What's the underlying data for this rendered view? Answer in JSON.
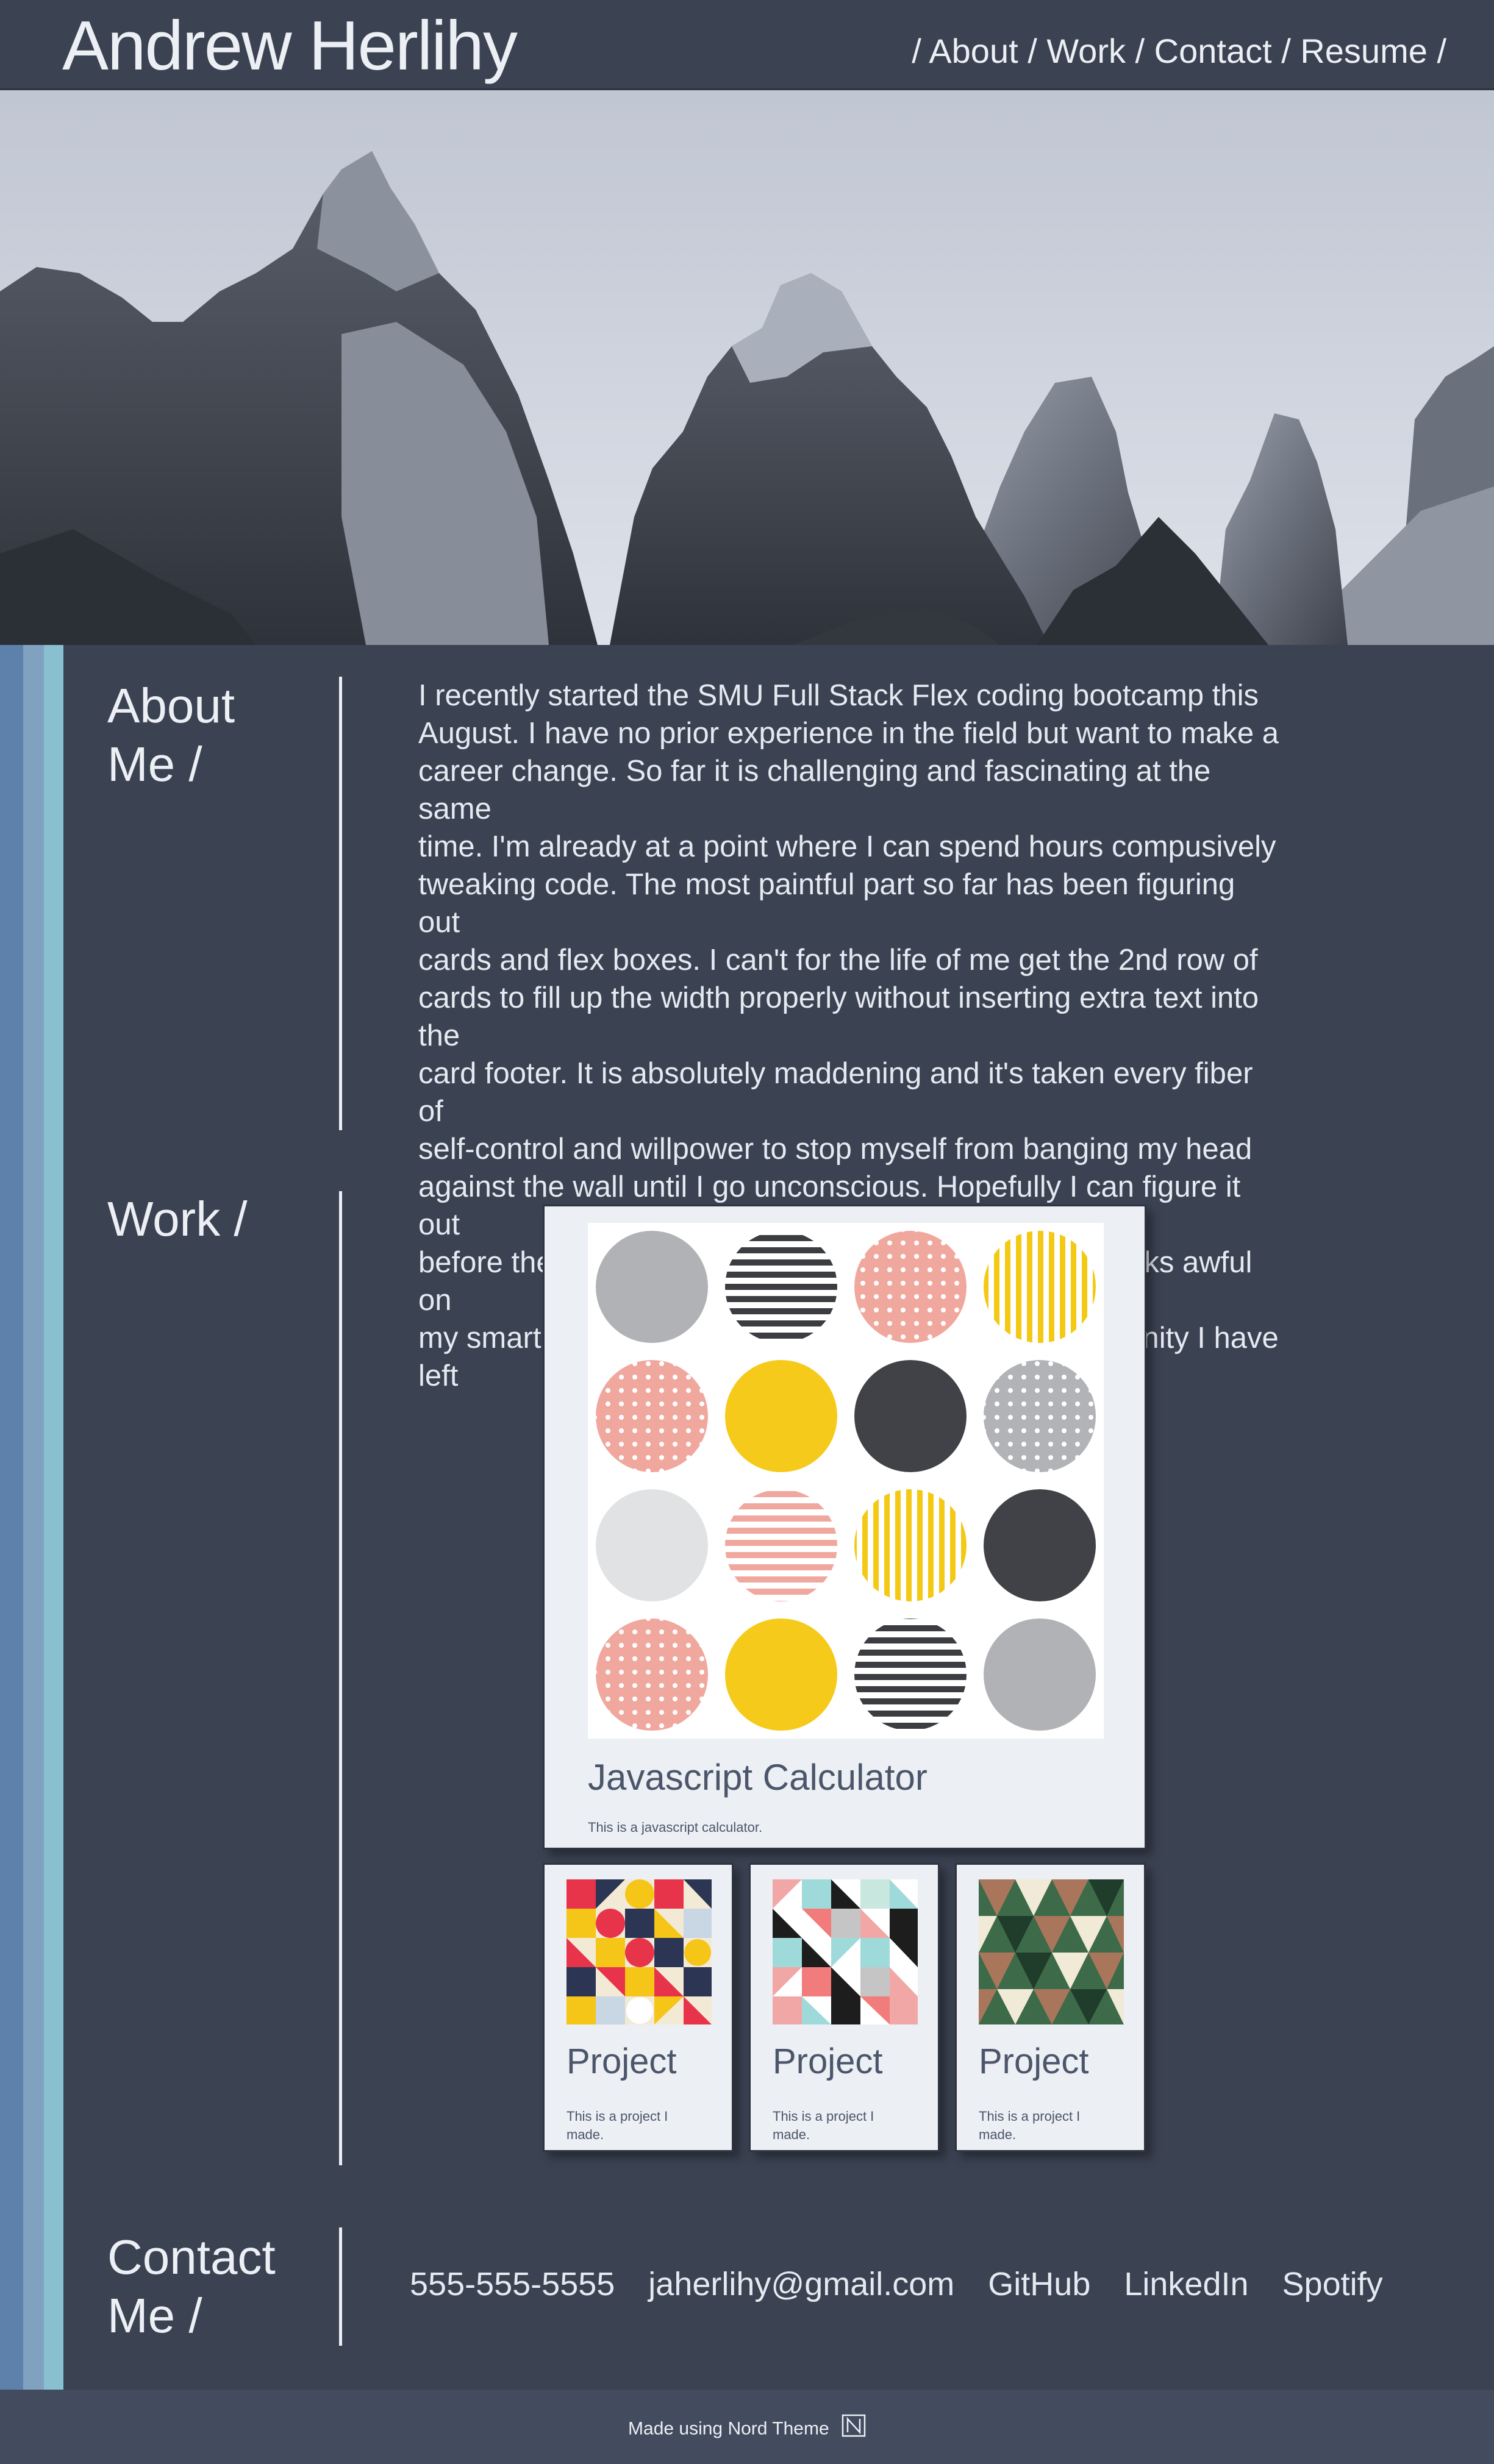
{
  "header": {
    "title": "Andrew Herlihy",
    "nav": [
      {
        "label": "About"
      },
      {
        "label": "Work"
      },
      {
        "label": "Contact"
      },
      {
        "label": "Resume"
      }
    ],
    "separator": "/"
  },
  "about": {
    "title_line1": "About",
    "title_line2": "Me /",
    "lines": [
      "I recently started the SMU Full Stack Flex coding bootcamp this",
      "August. I have no prior experience in the field but want to make a",
      "career change. So far it is challenging and fascinating at the same",
      "time. I'm already at a point where I can spend hours compusively",
      "tweaking code. The most paintful part so far has been figuring out",
      "cards and flex boxes. I can't for the life of me get the 2nd row of",
      "cards to fill up the width properly without inserting extra text into the",
      "card footer. It is absolutely maddening and it's taken every fiber of",
      "self-control and willpower to stop myself from banging my head",
      "against the wall until I go unconscious. Hopefully I can figure it out",
      "before the weekend gets here. Also, if my webpage looks awful on",
      "my smart phone I think I might lose the last shred of sanity I have left"
    ]
  },
  "work": {
    "title": "Work /",
    "main_card": {
      "title": "Javascript Calculator",
      "text": "This is a javascript calculator."
    },
    "small_cards": [
      {
        "title": "Project",
        "text_line1": "This is a project I",
        "text_line2": "made."
      },
      {
        "title": "Project",
        "text_line1": "This is a project I",
        "text_line2": "made."
      },
      {
        "title": "Project",
        "text_line1": "This is a project I",
        "text_line2": "made."
      }
    ]
  },
  "contact": {
    "title_line1": "Contact",
    "title_line2": "Me /",
    "links": [
      "555-555-5555",
      "jaherlihy@gmail.com",
      "GitHub",
      "LinkedIn",
      "Spotify"
    ]
  },
  "footer": {
    "text": "Made using Nord Theme",
    "icon": "nord-logo-icon"
  },
  "colors": {
    "background": "#3b4252",
    "stripe1": "#5e81ac",
    "stripe2": "#81a1c1",
    "stripe3": "#88c0d0",
    "card": "#eceff4",
    "footer": "#434c5e"
  }
}
